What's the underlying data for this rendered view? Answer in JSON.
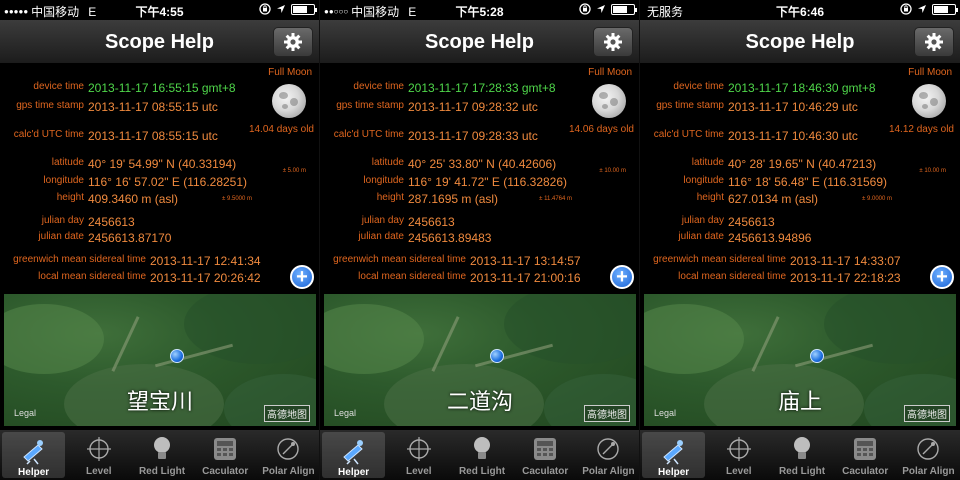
{
  "colors": {
    "label": "#e0661f",
    "value": "#f08a3e",
    "device_time": "#4fd64a",
    "accent_blue": "#1a63d6"
  },
  "labels": {
    "device_time": "device time",
    "gps_time_stamp": "gps time stamp",
    "calc_utc_time": "calc'd UTC time",
    "latitude": "latitude",
    "longitude": "longitude",
    "height": "height",
    "julian_day": "julian day",
    "julian_date": "julian date",
    "greenwich_mean_sidereal_time": "greenwich mean sidereal time",
    "local_mean_sidereal_time": "local mean sidereal time",
    "moon_phase": "Full Moon",
    "map_legal": "Legal",
    "map_brand": "高德地图"
  },
  "tabs": [
    {
      "label": "Helper",
      "icon": "telescope-icon"
    },
    {
      "label": "Level",
      "icon": "crosshair-icon"
    },
    {
      "label": "Red Light",
      "icon": "lightbulb-icon"
    },
    {
      "label": "Caculator",
      "icon": "calculator-icon"
    },
    {
      "label": "Polar Align",
      "icon": "compass-icon"
    }
  ],
  "screens": [
    {
      "status": {
        "carrier": "中国移动",
        "network": "E",
        "time": "下午4:55",
        "signal": "●●●●●"
      },
      "title": "Scope Help",
      "device_time": "2013-11-17 16:55:15 gmt+8",
      "gps_time_stamp": "2013-11-17 08:55:15 utc",
      "calc_utc_time": "2013-11-17 08:55:15 utc",
      "moon_age": "14.04 days old",
      "latitude": "40° 19' 54.99\" N (40.33194)",
      "longitude": "116° 16' 57.02\" E (116.28251)",
      "position_accuracy": "± 5.00 m",
      "height": "409.3460 m (asl)",
      "height_accuracy": "± 9.5000 m",
      "julian_day": "2456613",
      "julian_date": "2456613.87170",
      "gmst": "2013-11-17 12:41:34",
      "lmst": "2013-11-17 20:26:42",
      "place_name": "望宝川"
    },
    {
      "status": {
        "carrier": "中国移动",
        "network": "E",
        "time": "下午5:28",
        "signal": "●●○○○"
      },
      "title": "Scope Help",
      "device_time": "2013-11-17 17:28:33 gmt+8",
      "gps_time_stamp": "2013-11-17 09:28:32 utc",
      "calc_utc_time": "2013-11-17 09:28:33 utc",
      "moon_age": "14.06 days old",
      "latitude": "40° 25' 33.80\" N (40.42606)",
      "longitude": "116° 19' 41.72\" E (116.32826)",
      "position_accuracy": "± 10.00 m",
      "height": "287.1695 m (asl)",
      "height_accuracy": "± 11.4764 m",
      "julian_day": "2456613",
      "julian_date": "2456613.89483",
      "gmst": "2013-11-17 13:14:57",
      "lmst": "2013-11-17 21:00:16",
      "place_name": "二道沟"
    },
    {
      "status": {
        "carrier": "无服务",
        "network": "",
        "time": "下午6:46",
        "signal": ""
      },
      "title": "Scope Help",
      "device_time": "2013-11-17 18:46:30 gmt+8",
      "gps_time_stamp": "2013-11-17 10:46:29 utc",
      "calc_utc_time": "2013-11-17 10:46:30 utc",
      "moon_age": "14.12 days old",
      "latitude": "40° 28' 19.65\" N (40.47213)",
      "longitude": "116° 18' 56.48\" E (116.31569)",
      "position_accuracy": "± 10.00 m",
      "height": "627.0134 m (asl)",
      "height_accuracy": "± 9.0000 m",
      "julian_day": "2456613",
      "julian_date": "2456613.94896",
      "gmst": "2013-11-17 14:33:07",
      "lmst": "2013-11-17 22:18:23",
      "place_name": "庙上"
    }
  ]
}
